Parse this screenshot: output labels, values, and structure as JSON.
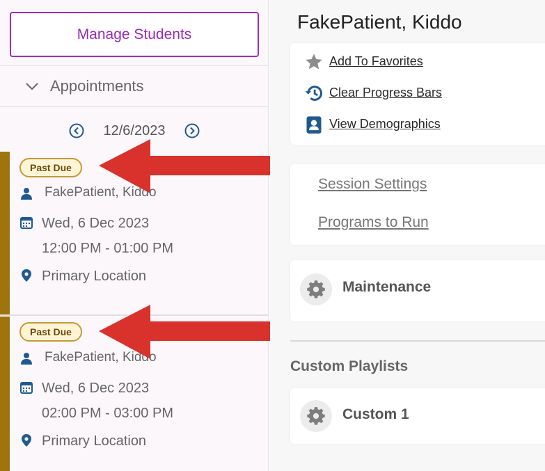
{
  "left": {
    "manage_students": "Manage Students",
    "appointments_header": "Appointments",
    "date_nav": {
      "date": "12/6/2023"
    },
    "appointments": [
      {
        "status": "Past Due",
        "patient": "FakePatient, Kiddo",
        "date": "Wed, 6 Dec 2023",
        "time": "12:00 PM - 01:00 PM",
        "location": "Primary Location"
      },
      {
        "status": "Past Due",
        "patient": "FakePatient, Kiddo",
        "date": "Wed, 6 Dec 2023",
        "time": "02:00 PM - 03:00 PM",
        "location": "Primary Location"
      }
    ]
  },
  "right": {
    "patient_title": "FakePatient, Kiddo",
    "actions": {
      "favorites": "Add To Favorites",
      "clear_progress": "Clear Progress Bars",
      "demographics": "View Demographics"
    },
    "session": {
      "settings": "Session Settings",
      "programs": "Programs to Run"
    },
    "maintenance": "Maintenance",
    "custom_playlists_title": "Custom Playlists",
    "custom_1": "Custom 1"
  },
  "colors": {
    "accent_purple": "#a12ac0",
    "past_due_bar": "#a0740d",
    "badge_bg": "#fff5d6",
    "icon_blue": "#1f5a8f",
    "arrow_red": "#d9312b"
  }
}
